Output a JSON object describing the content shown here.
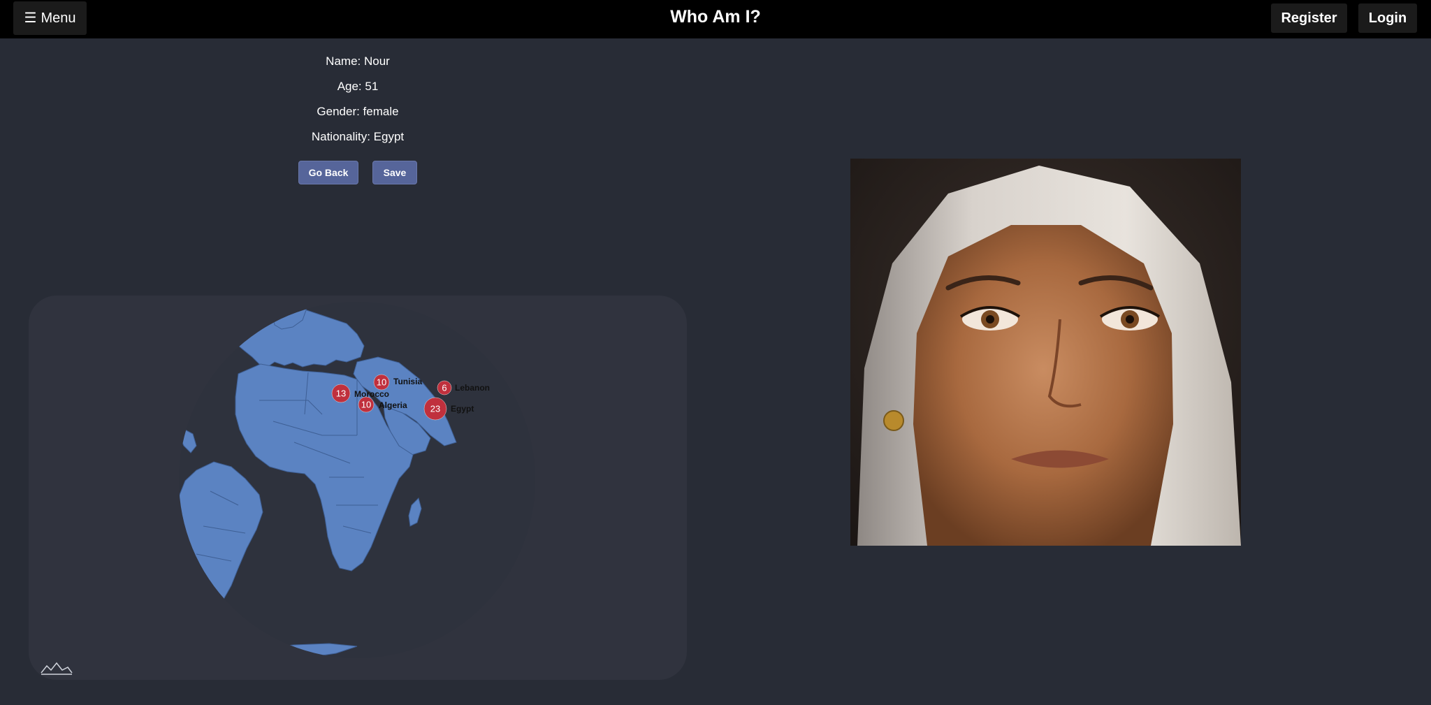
{
  "header": {
    "menu_icon": "hamburger-icon",
    "menu_label": "Menu",
    "title": "Who Am I?",
    "register_label": "Register",
    "login_label": "Login"
  },
  "profile": {
    "name_label": "Name: Nour",
    "age_label": "Age: 51",
    "gender_label": "Gender: female",
    "nationality_label": "Nationality: Egypt"
  },
  "actions": {
    "go_back_label": "Go Back",
    "save_label": "Save"
  },
  "map": {
    "colors": {
      "ocean_globe": "#2e323d",
      "land": "#5b83c2",
      "border": "#3e5f94",
      "marker": "#c0303d"
    },
    "markers": [
      {
        "country": "Morocco",
        "count": "13"
      },
      {
        "country": "Tunisia",
        "count": "10"
      },
      {
        "country": "Algeria",
        "count": "10"
      },
      {
        "country": "Lebanon",
        "count": "6"
      },
      {
        "country": "Egypt",
        "count": "23"
      }
    ],
    "logo_icon": "mountain-logo-icon"
  },
  "portrait": {
    "icon": "portrait-photo"
  }
}
